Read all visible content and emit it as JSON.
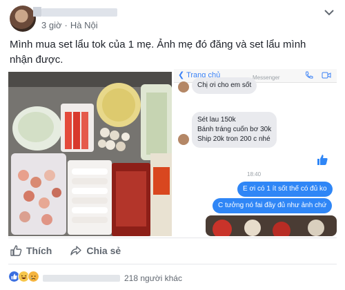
{
  "header": {
    "time": "3 giờ",
    "separator": "·",
    "location": "Hà Nội"
  },
  "post": {
    "text": "Mình mua set lẩu tok của 1 mẹ. Ảnh mẹ đó đăng và set lẩu mình nhận được."
  },
  "messenger": {
    "back_label": "❮ Trang chủ",
    "app_label": "Messenger",
    "messages": [
      "Chị ơi cho em sốt",
      "Sét lau 150k\nBánh tráng cuốn bơ 30k\nShip 20k tron 200 c nhé",
      "E ơi có 1 ít sốt thế có đủ ko",
      "C tưởng nó fai đầy đủ như ảnh chứ"
    ],
    "timestamp": "18:40"
  },
  "actions": {
    "like_label": "Thích",
    "share_label": "Chia sẻ"
  },
  "reactions": {
    "count_text": "218 người khác",
    "colors": {
      "like": "#3b6fe0",
      "haha": "#f7c64a",
      "sad": "#f5b43f"
    }
  },
  "colors": {
    "bubble_out": "#2f86f6",
    "bubble_in": "#e9eaee",
    "meta_text": "#606770"
  }
}
